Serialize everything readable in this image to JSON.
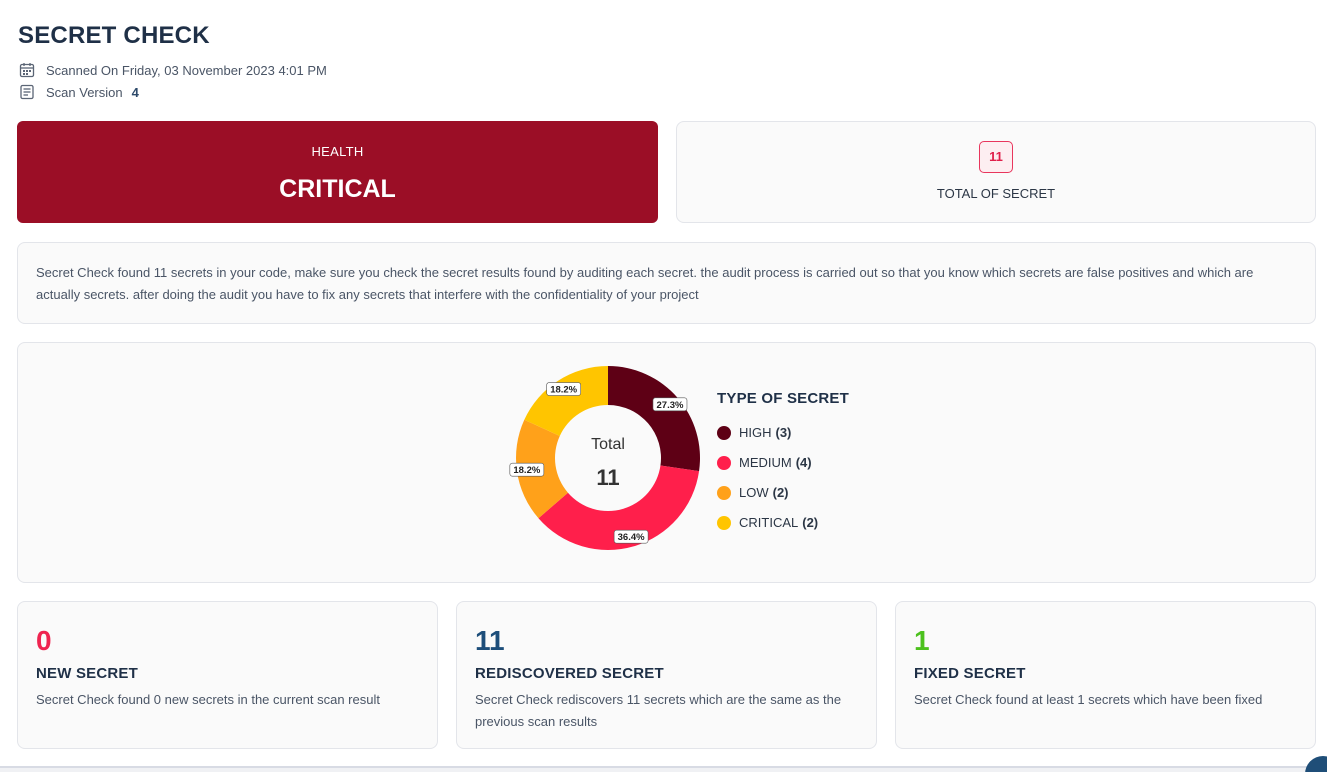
{
  "header": {
    "title": "SECRET CHECK",
    "scanned_label": "Scanned On Friday, 03 November 2023 4:01 PM",
    "version_label": "Scan Version",
    "version_value": "4"
  },
  "health": {
    "label": "HEALTH",
    "value": "CRITICAL",
    "color": "#9b0e26"
  },
  "total": {
    "count": "11",
    "label": "TOTAL OF SECRET"
  },
  "description": "Secret Check found 11 secrets in your code, make sure you check the secret results found by auditing each secret. the audit process is carried out so that you know which secrets are false positives and which are actually secrets. after doing the audit you have to fix any secrets that interfere with the confidentiality of your project",
  "chart_data": {
    "type": "pie",
    "donut": true,
    "center_label": "Total",
    "center_value": "11",
    "legend_title": "TYPE OF SECRET",
    "legend_placement": "right",
    "slices": [
      {
        "name": "HIGH",
        "count": "(3)",
        "value": 3,
        "percent_label": "27.3%",
        "color": "#5e0015"
      },
      {
        "name": "MEDIUM",
        "count": "(4)",
        "value": 4,
        "percent_label": "36.4%",
        "color": "#ff1f4b"
      },
      {
        "name": "LOW",
        "count": "(2)",
        "value": 2,
        "percent_label": "18.2%",
        "color": "#ffa11a"
      },
      {
        "name": "CRITICAL",
        "count": "(2)",
        "value": 2,
        "percent_label": "18.2%",
        "color": "#ffc500"
      }
    ]
  },
  "stats": [
    {
      "number": "0",
      "title": "NEW SECRET",
      "text": "Secret Check found 0 new secrets in the current scan result",
      "color": "#ef2450"
    },
    {
      "number": "11",
      "title": "REDISCOVERED SECRET",
      "text": "Secret Check rediscovers 11 secrets which are the same as the previous scan results",
      "color": "#1d4e7a"
    },
    {
      "number": "1",
      "title": "FIXED SECRET",
      "text": "Secret Check found at least 1 secrets which have been fixed",
      "color": "#4cc11d"
    }
  ],
  "icons": {
    "calendar": "calendar-icon",
    "version": "document-icon"
  }
}
